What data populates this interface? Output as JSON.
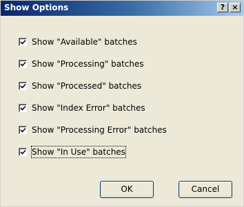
{
  "window": {
    "title": "Show Options",
    "help_label": "?",
    "close_label": "×"
  },
  "options": [
    {
      "label": "Show \"Available\" batches",
      "checked": true
    },
    {
      "label": "Show \"Processing\" batches",
      "checked": true
    },
    {
      "label": "Show \"Processed\" batches",
      "checked": true
    },
    {
      "label": "Show \"Index Error\" batches",
      "checked": true
    },
    {
      "label": "Show \"Processing Error\" batches",
      "checked": true
    },
    {
      "label": "Show \"In Use\" batches",
      "checked": true
    }
  ],
  "buttons": {
    "ok_label": "OK",
    "cancel_label": "Cancel"
  },
  "colors": {
    "title_start": "#0a246a",
    "title_end": "#a6caf0",
    "face": "#ece9d8"
  }
}
